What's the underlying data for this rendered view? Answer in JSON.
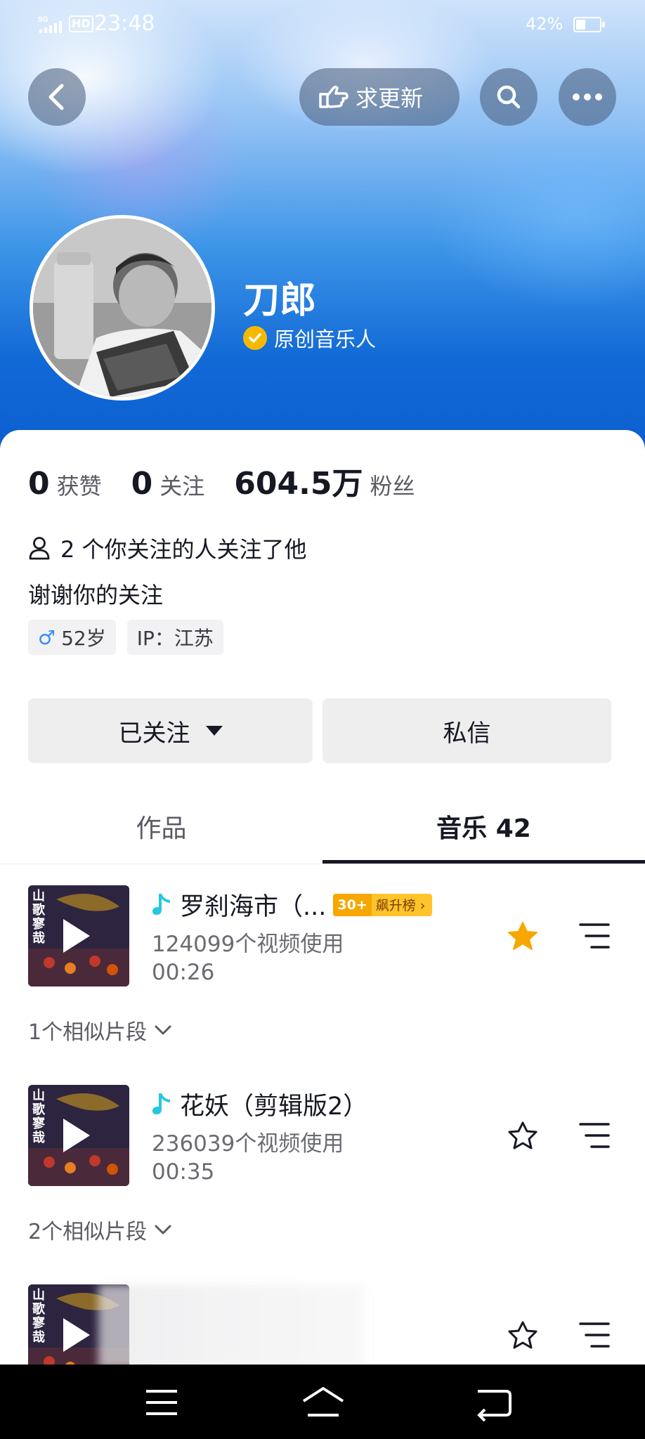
{
  "status_bar": {
    "network": "5G",
    "hd": "HD",
    "time": "23:48",
    "battery_text": "42%",
    "battery_level": 0.42
  },
  "top_bar": {
    "back_icon": "back-arrow-icon",
    "request_update_label": "求更新",
    "search_icon": "search-icon",
    "more_icon": "more-dots-icon"
  },
  "profile": {
    "name": "刀郎",
    "verification": "原创音乐人",
    "avatar_icon": "avatar-photo",
    "stats": [
      {
        "value": "0",
        "label": "获赞"
      },
      {
        "value": "0",
        "label": "关注"
      },
      {
        "value": "604.5万",
        "label": "粉丝"
      }
    ],
    "mutual_follow": "2 个你关注的人关注了他",
    "bio": "谢谢你的关注",
    "tags": {
      "age": "52岁",
      "ip": "IP：江苏"
    }
  },
  "actions": {
    "follow_label": "已关注",
    "message_label": "私信"
  },
  "tabs": [
    {
      "label": "作品",
      "active": false
    },
    {
      "label": "音乐 42",
      "active": true
    }
  ],
  "music": [
    {
      "title": "罗刹海市（...",
      "badge_rank": "30+",
      "badge_label": "飙升榜 ›",
      "usage": "124099个视频使用",
      "duration": "00:26",
      "favorited": true,
      "similar": "1个相似片段"
    },
    {
      "title": "花妖（剪辑版2）",
      "usage": "236039个视频使用",
      "duration": "00:35",
      "favorited": false,
      "similar": "2个相似片段"
    },
    {
      "title": "",
      "usage": "",
      "duration": "",
      "favorited": false
    }
  ],
  "cover_text": "山歌寥哉",
  "colors": {
    "accent_gold": "#f7b900",
    "star_orange": "#f6a700",
    "tiktok_cyan": "#25c7e0",
    "banner_blue": "#1169d6"
  }
}
